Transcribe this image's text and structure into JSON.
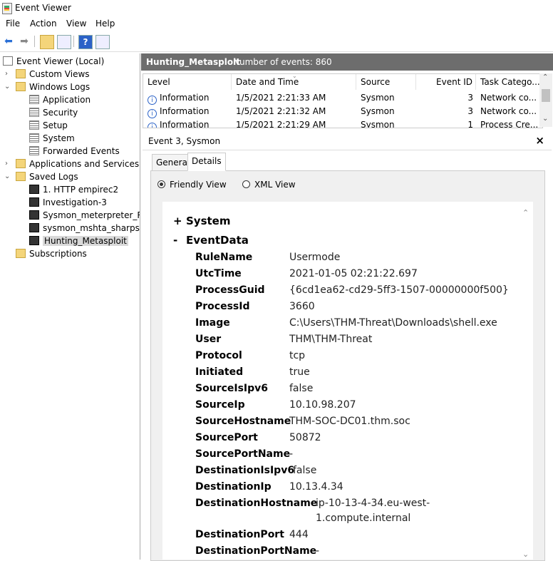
{
  "window": {
    "title": "Event Viewer"
  },
  "menu": [
    "File",
    "Action",
    "View",
    "Help"
  ],
  "toolbar": {
    "back_glyph": "⬅",
    "forward_glyph": "➡",
    "help_glyph": "?"
  },
  "tree": {
    "root": "Event Viewer (Local)",
    "custom_views": "Custom Views",
    "windows_logs": "Windows Logs",
    "windows_logs_items": [
      "Application",
      "Security",
      "Setup",
      "System",
      "Forwarded Events"
    ],
    "apps_services": "Applications and Services Lo",
    "saved_logs": "Saved Logs",
    "saved_logs_items": [
      "1. HTTP empirec2",
      "Investigation-3",
      "Sysmon_meterpreter_Ref",
      "sysmon_mshta_sharpsho",
      "Hunting_Metasploit"
    ],
    "subscriptions": "Subscriptions"
  },
  "log_header": {
    "name": "Hunting_Metasploit",
    "count": "Number of events: 860"
  },
  "grid": {
    "columns": [
      "Level",
      "Date and Time",
      "Source",
      "Event ID",
      "Task Catego..."
    ],
    "rows": [
      {
        "level": "Information",
        "date": "1/5/2021 2:21:33 AM",
        "source": "Sysmon",
        "event_id": "3",
        "task": "Network co..."
      },
      {
        "level": "Information",
        "date": "1/5/2021 2:21:32 AM",
        "source": "Sysmon",
        "event_id": "3",
        "task": "Network co..."
      },
      {
        "level": "Information",
        "date": "1/5/2021 2:21:29 AM",
        "source": "Sysmon",
        "event_id": "1",
        "task": "Process Cre..."
      }
    ]
  },
  "detail": {
    "title": "Event 3, Sysmon",
    "close": "×",
    "tabs": [
      "General",
      "Details"
    ],
    "radio_friendly": "Friendly View",
    "radio_xml": "XML View",
    "system_toggle": "+",
    "system_label": "System",
    "eventdata_toggle": "-",
    "eventdata_label": "EventData",
    "fields": [
      {
        "k": "RuleName",
        "v": "Usermode"
      },
      {
        "k": "UtcTime",
        "v": "2021-01-05 02:21:22.697"
      },
      {
        "k": "ProcessGuid",
        "v": "{6cd1ea62-cd29-5ff3-1507-00000000f500}"
      },
      {
        "k": "ProcessId",
        "v": "3660"
      },
      {
        "k": "Image",
        "v": "C:\\Users\\THM-Threat\\Downloads\\shell.exe"
      },
      {
        "k": "User",
        "v": "THM\\THM-Threat"
      },
      {
        "k": "Protocol",
        "v": "tcp"
      },
      {
        "k": "Initiated",
        "v": "true"
      },
      {
        "k": "SourceIsIpv6",
        "v": "false"
      },
      {
        "k": "SourceIp",
        "v": "10.10.98.207"
      },
      {
        "k": "SourceHostname",
        "v": "THM-SOC-DC01.thm.soc"
      },
      {
        "k": "SourcePort",
        "v": "50872"
      },
      {
        "k": "SourcePortName",
        "v": "-"
      },
      {
        "k": "DestinationIsIpv6",
        "v": "false"
      },
      {
        "k": "DestinationIp",
        "v": "10.13.4.34"
      },
      {
        "k": "DestinationHostname",
        "v": "ip-10-13-4-34.eu-west-",
        "v2": "1.compute.internal"
      },
      {
        "k": "DestinationPort",
        "v": "444"
      },
      {
        "k": "DestinationPortName",
        "v": "-"
      }
    ]
  }
}
